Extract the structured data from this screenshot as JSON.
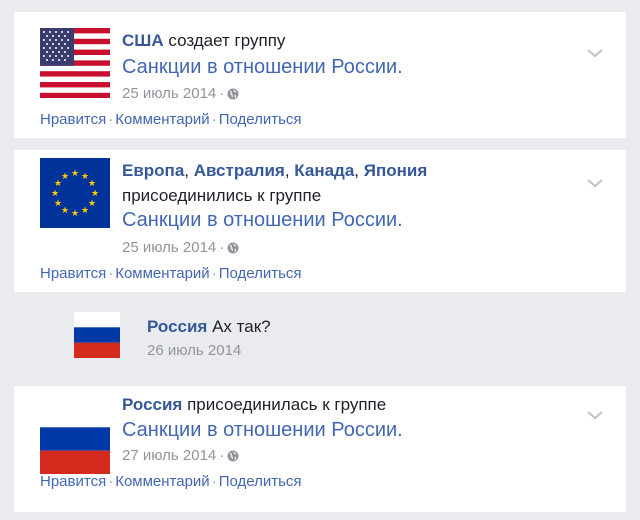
{
  "posts": [
    {
      "names": [
        "США"
      ],
      "action": "создает группу",
      "group": "Санкции в отношении России.",
      "date": "25 июль 2014",
      "actions": {
        "like": "Нравится",
        "comment": "Комментарий",
        "share": "Поделиться"
      },
      "flag": "usa-flag"
    },
    {
      "names": [
        "Европа",
        "Австралия",
        "Канада",
        "Япония"
      ],
      "action": "присоединились к группе",
      "group": "Санкции в отношении России.",
      "date": "25 июль 2014",
      "actions": {
        "like": "Нравится",
        "comment": "Комментарий",
        "share": "Поделиться"
      },
      "flag": "eu-flag"
    },
    {
      "names": [
        "Россия"
      ],
      "action": "присоединилась к группе",
      "group": "Санкции в отношении России.",
      "date": "27 июль 2014",
      "actions": {
        "like": "Нравится",
        "comment": "Комментарий",
        "share": "Поделиться"
      },
      "flag": "russia-flag"
    }
  ],
  "comment": {
    "name": "Россия",
    "text": "Ах так?",
    "date": "26 июль 2014",
    "flag": "russia-flag"
  },
  "colors": {
    "link": "#365899",
    "group_link": "#4267b2",
    "meta": "#90949c",
    "background": "#e9ebee"
  }
}
